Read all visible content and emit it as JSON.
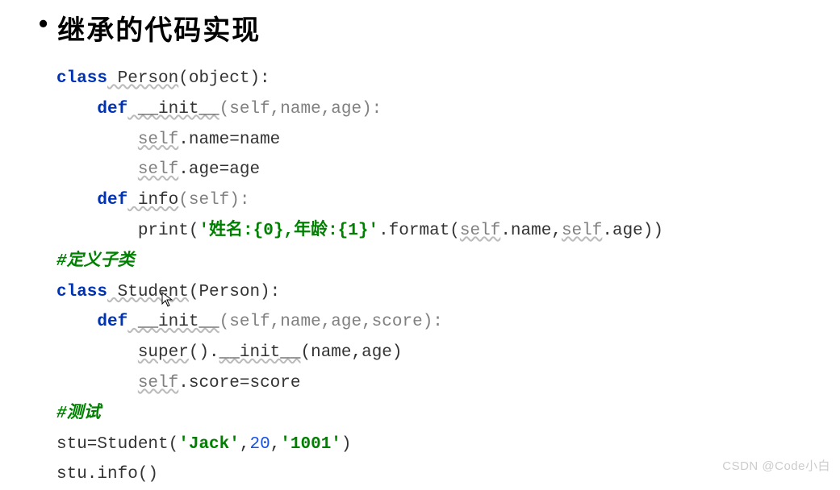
{
  "heading": {
    "bullet": "•",
    "text": "继承的代码实现"
  },
  "code": {
    "line1": {
      "kw1": "class",
      "cls": " Person",
      "rest": "(object):"
    },
    "line2": {
      "indent": "    ",
      "kw": "def",
      "name": " __init__",
      "params": "(self,name,age):"
    },
    "line3": {
      "indent": "        ",
      "self": "self",
      "rest": ".name=name"
    },
    "line4": {
      "indent": "        ",
      "self": "self",
      "rest": ".age=age"
    },
    "line5": {
      "indent": "    ",
      "kw": "def",
      "name": " info",
      "params": "(self):"
    },
    "line6": {
      "indent": "        ",
      "func": "print",
      "open": "(",
      "str": "'姓名:{0},年龄:{1}'",
      "rest1": ".format(",
      "self1": "self",
      "rest2": ".name,",
      "self2": "self",
      "rest3": ".age))"
    },
    "line7": {
      "comment": "#定义子类"
    },
    "line8": {
      "kw": "class",
      "cls": " Student",
      "rest": "(Person):"
    },
    "line9": {
      "indent": "    ",
      "kw": "def",
      "name": " __init__",
      "params": "(self,name,age,score):"
    },
    "line10": {
      "indent": "        ",
      "super": "super",
      "rest1": "().",
      "init": "__init__",
      "rest2": "(name,age)"
    },
    "line11": {
      "indent": "        ",
      "self": "self",
      "rest": ".score=score"
    },
    "line12": {
      "comment": "#测试"
    },
    "line13": {
      "prefix": "stu=Student(",
      "str1": "'Jack'",
      "comma1": ",",
      "num": "20",
      "comma2": ",",
      "str2": "'1001'",
      "close": ")"
    },
    "line14": {
      "text": "stu.info()"
    }
  },
  "watermark": "CSDN @Code小白"
}
